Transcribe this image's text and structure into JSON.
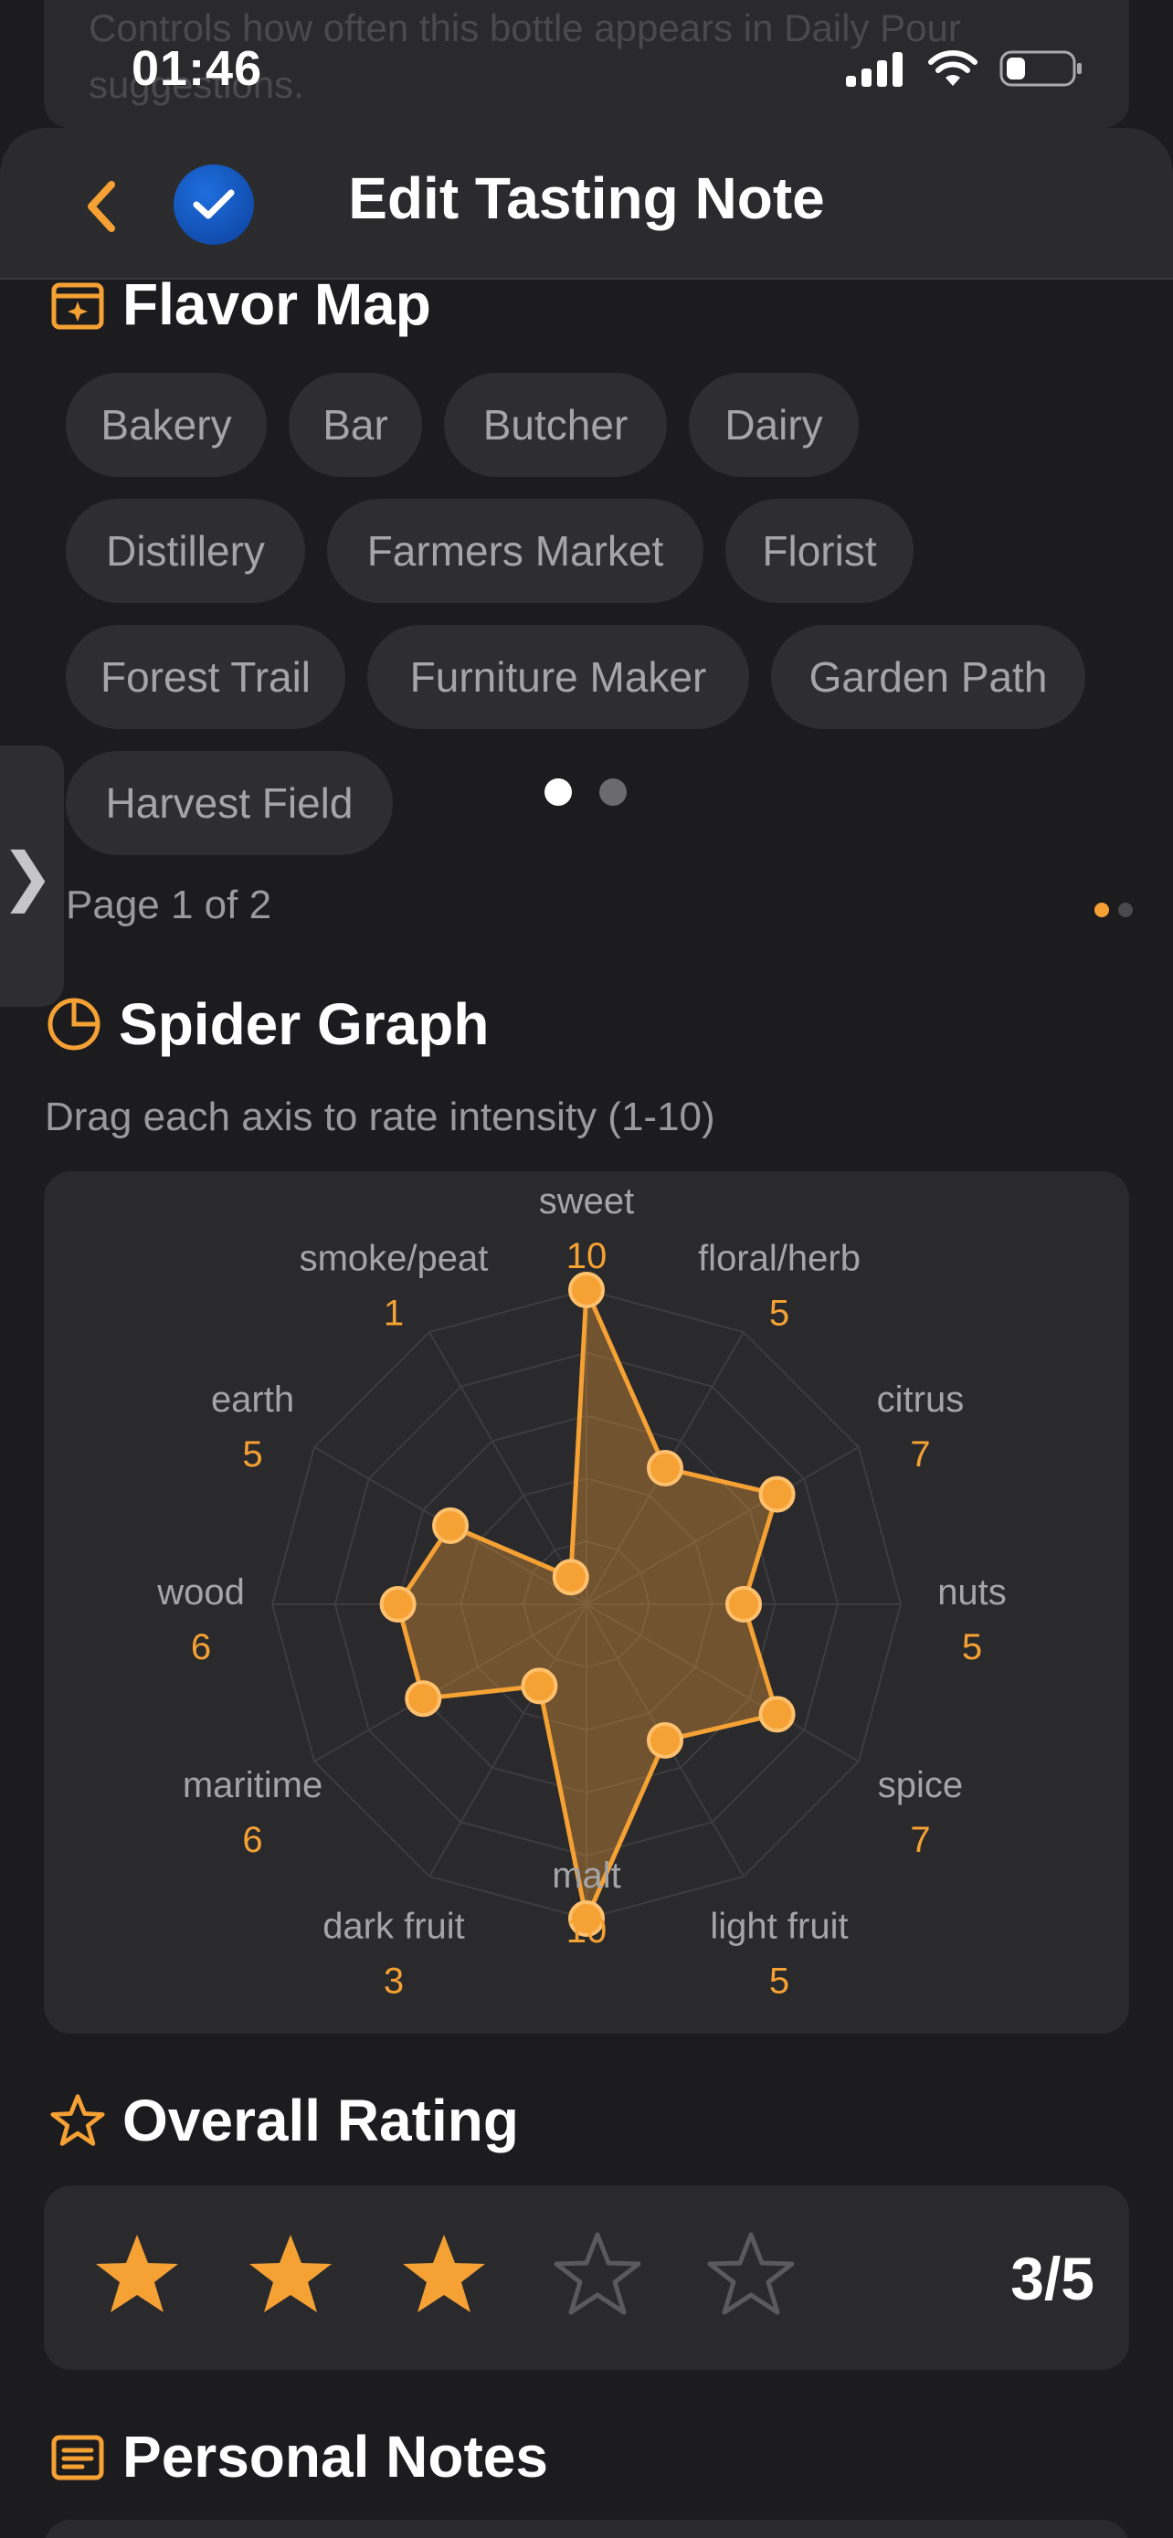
{
  "background": {
    "text": "Controls how often this bottle appears in Daily Pour suggestions."
  },
  "status_bar": {
    "time": "01:46"
  },
  "nav": {
    "title": "Edit Tasting Note"
  },
  "flavor_map": {
    "title": "Flavor Map",
    "chips": [
      "Bakery",
      "Bar",
      "Butcher",
      "Dairy",
      "Distillery",
      "Farmers Market",
      "Florist",
      "Forest Trail",
      "Furniture Maker",
      "Garden Path",
      "Harvest Field"
    ],
    "page_label": "Page 1 of 2",
    "current_page": 1,
    "total_pages": 2
  },
  "spider": {
    "title": "Spider Graph",
    "subtitle": "Drag each axis to rate intensity (1-10)"
  },
  "chart_data": {
    "type": "radar",
    "axes": [
      "sweet",
      "floral/herb",
      "citrus",
      "nuts",
      "spice",
      "light fruit",
      "malt",
      "dark fruit",
      "maritime",
      "wood",
      "earth",
      "smoke/peat"
    ],
    "values": [
      10,
      5,
      7,
      5,
      7,
      5,
      10,
      3,
      6,
      6,
      5,
      1
    ],
    "range": [
      0,
      10
    ],
    "grid": true,
    "color": "#f5a134"
  },
  "rating": {
    "title": "Overall Rating",
    "value": 3,
    "max": 5,
    "label": "3/5"
  },
  "notes": {
    "title": "Personal Notes"
  },
  "colors": {
    "accent": "#f5a134",
    "card": "#2a2a2d",
    "chip": "#2e2e31",
    "background": "#1c1c1e"
  }
}
